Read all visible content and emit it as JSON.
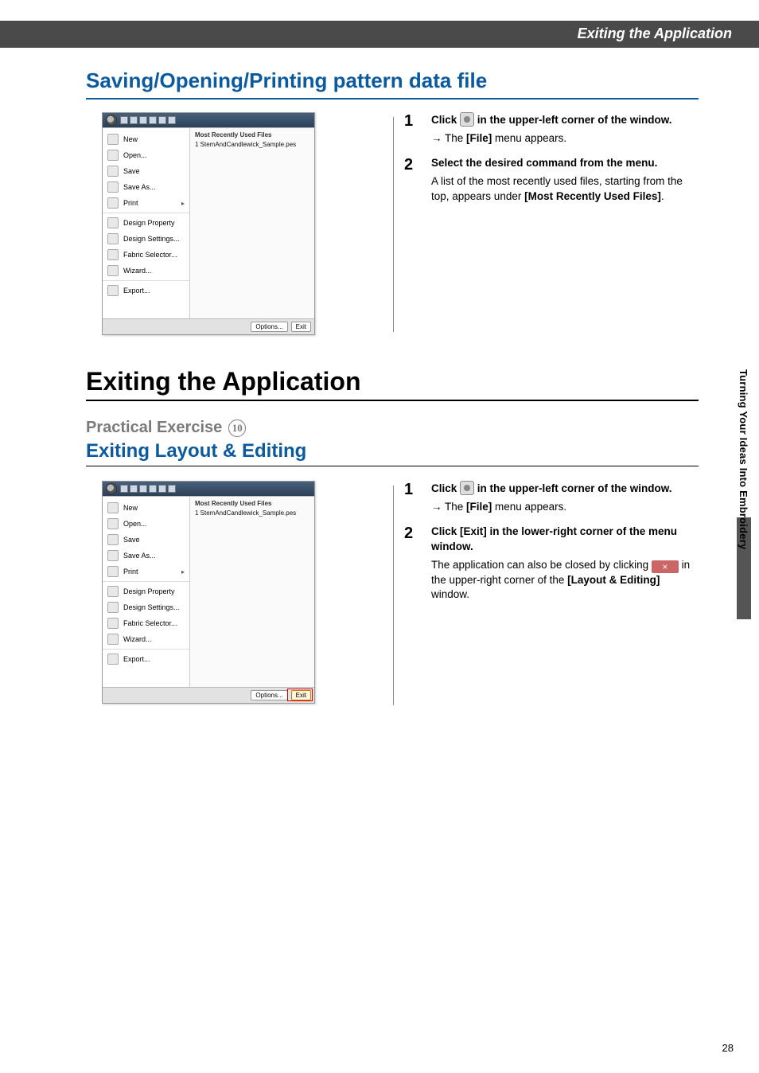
{
  "header": {
    "title": "Exiting the Application"
  },
  "sectionA": {
    "title": "Saving/Opening/Printing pattern data file",
    "menu": {
      "items": [
        {
          "label": "New"
        },
        {
          "label": "Open..."
        },
        {
          "label": "Save"
        },
        {
          "label": "Save As..."
        },
        {
          "label": "Print",
          "has_submenu": true
        },
        {
          "label": "Design Property"
        },
        {
          "label": "Design Settings..."
        },
        {
          "label": "Fabric Selector..."
        },
        {
          "label": "Wizard..."
        },
        {
          "label": "Export..."
        }
      ],
      "recent_header": "Most Recently Used Files",
      "recent_items": [
        "1 StemAndCandlewick_Sample.pes"
      ],
      "footer": {
        "options": "Options...",
        "exit": "Exit"
      }
    },
    "steps": [
      {
        "num": "1",
        "lead_pre": "Click ",
        "lead_post": " in the upper-left corner of the window.",
        "follow_arrow": "→",
        "follow_pre": "The ",
        "follow_bold": "[File]",
        "follow_post": " menu appears."
      },
      {
        "num": "2",
        "lead": "Select the desired command from the menu.",
        "body1": "A list of the most recently used files, starting from the top, appears under ",
        "body1_bold": "[Most Recently Used Files]",
        "body1_post": "."
      }
    ]
  },
  "sectionB": {
    "big_title": "Exiting the Application",
    "practice_label": "Practical Exercise",
    "practice_num": "10",
    "sub_title": "Exiting Layout & Editing",
    "menu": {
      "items": [
        {
          "label": "New"
        },
        {
          "label": "Open..."
        },
        {
          "label": "Save"
        },
        {
          "label": "Save As..."
        },
        {
          "label": "Print",
          "has_submenu": true
        },
        {
          "label": "Design Property"
        },
        {
          "label": "Design Settings..."
        },
        {
          "label": "Fabric Selector..."
        },
        {
          "label": "Wizard..."
        },
        {
          "label": "Export..."
        }
      ],
      "recent_header": "Most Recently Used Files",
      "recent_items": [
        "1 StemAndCandlewick_Sample.pes"
      ],
      "footer": {
        "options": "Options...",
        "exit": "Exit"
      }
    },
    "steps": [
      {
        "num": "1",
        "lead_pre": "Click ",
        "lead_post": " in the upper-left corner of the window.",
        "follow_arrow": "→",
        "follow_pre": "The ",
        "follow_bold": "[File]",
        "follow_post": " menu appears."
      },
      {
        "num": "2",
        "lead": "Click [Exit] in the lower-right corner of the menu window.",
        "body1": "The application can also be closed by clicking ",
        "body1_post": " in the upper-right corner of the ",
        "body1_bold": "[Layout & Editing]",
        "body1_tail": " window."
      }
    ]
  },
  "sidebar": {
    "text": "Turning Your Ideas Into Embroidery"
  },
  "page_number": "28",
  "close_x": "×"
}
